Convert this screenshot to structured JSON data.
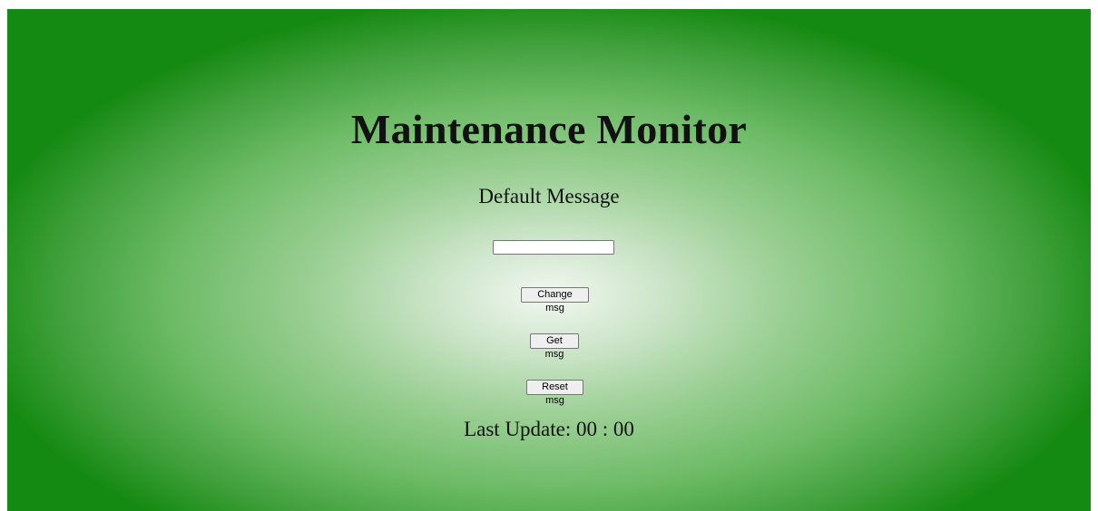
{
  "page": {
    "title": "Maintenance Monitor",
    "message": "Default Message",
    "input": {
      "value": "",
      "placeholder": ""
    },
    "buttons": {
      "change": "Change msg",
      "get": "Get msg",
      "reset": "Reset msg"
    },
    "last_update": {
      "label": "Last Update:",
      "time": "00 : 00"
    }
  },
  "colors": {
    "background_center": "#f2f8f1",
    "background_edge": "#158a12",
    "text": "#111111"
  }
}
